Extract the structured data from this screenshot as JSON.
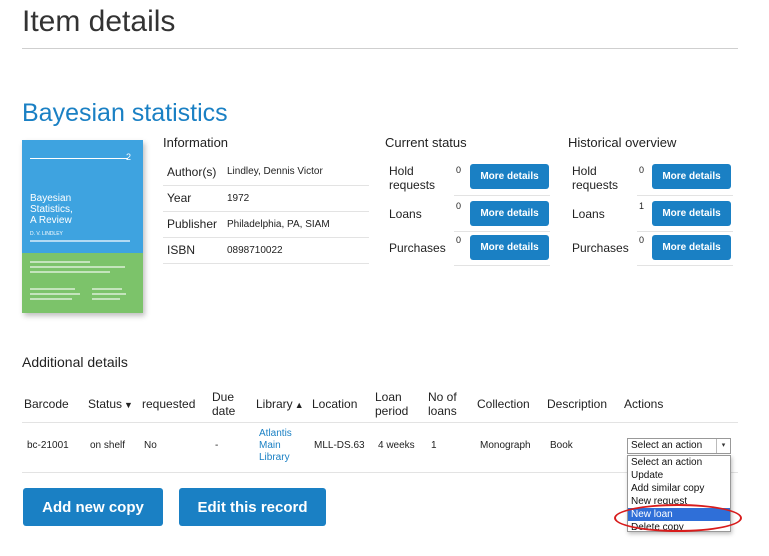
{
  "page": {
    "title": "Item details"
  },
  "record": {
    "title": "Bayesian statistics",
    "cover": {
      "title": "Bayesian\nStatistics,\nA Review",
      "number": "2",
      "author": "D. V. LINDLEY"
    }
  },
  "information": {
    "heading": "Information",
    "rows": [
      {
        "label": "Author(s)",
        "value": "Lindley, Dennis Victor"
      },
      {
        "label": "Year",
        "value": "1972"
      },
      {
        "label": "Publisher",
        "value": "Philadelphia, PA, SIAM"
      },
      {
        "label": "ISBN",
        "value": "0898710022"
      }
    ]
  },
  "current_status": {
    "heading": "Current status",
    "rows": [
      {
        "label": "Hold\nrequests",
        "count": "0",
        "button": "More details"
      },
      {
        "label": "Loans",
        "count": "0",
        "button": "More details"
      },
      {
        "label": "Purchases",
        "count": "0",
        "button": "More details"
      }
    ]
  },
  "historical_overview": {
    "heading": "Historical overview",
    "rows": [
      {
        "label": "Hold\nrequests",
        "count": "0",
        "button": "More details"
      },
      {
        "label": "Loans",
        "count": "1",
        "button": "More details"
      },
      {
        "label": "Purchases",
        "count": "0",
        "button": "More details"
      }
    ]
  },
  "additional": {
    "heading": "Additional details",
    "columns": [
      "Barcode",
      "Status",
      "requested",
      "Due\ndate",
      "Library",
      "Location",
      "Loan\nperiod",
      "No of\nloans",
      "Collection",
      "Description",
      "Actions"
    ],
    "sort_icons": {
      "status": "▼",
      "library": "▲"
    },
    "row": {
      "barcode": "bc-21001",
      "status": "on shelf",
      "requested": "No",
      "due_date": "-",
      "library": "Atlantis\nMain\nLibrary",
      "location": "MLL-DS.63",
      "loan_period": "4 weeks",
      "no_of_loans": "1",
      "collection": "Monograph",
      "description": "Book"
    },
    "action_select": {
      "selected": "Select an action",
      "options": [
        "Select an action",
        "Update",
        "Add similar copy",
        "New request",
        "New loan",
        "Delete copy"
      ],
      "highlighted": "New loan"
    }
  },
  "buttons": {
    "add_copy": "Add new copy",
    "edit_record": "Edit this record"
  },
  "colors": {
    "accent": "#1a80c4",
    "highlight": "#d81c1c"
  }
}
